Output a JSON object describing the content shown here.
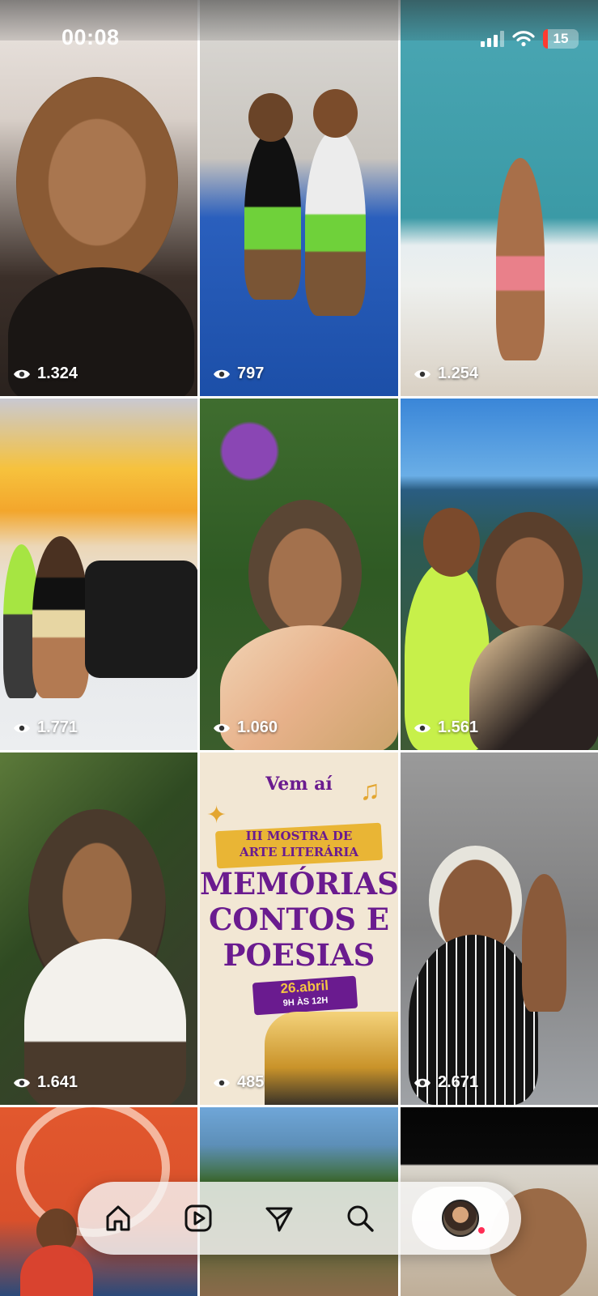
{
  "status_bar": {
    "time": "00:08",
    "battery": "15",
    "icons": [
      "signal-icon",
      "wifi-icon",
      "battery-icon"
    ]
  },
  "grid": {
    "tiles": [
      {
        "views": "1.324"
      },
      {
        "views": "797"
      },
      {
        "views": "1.254"
      },
      {
        "views": "1.771"
      },
      {
        "views": "1.060"
      },
      {
        "views": "1.561"
      },
      {
        "views": "1.641"
      },
      {
        "views": "485"
      },
      {
        "views": "2.671"
      }
    ]
  },
  "poster": {
    "kicker": "Vem aí",
    "subtitle_line1": "III MOSTRA DE",
    "subtitle_line2": "ARTE LITERÁRIA",
    "title_line1": "MEMÓRIAS,",
    "title_line2": "CONTOS E",
    "title_line3": "POESIAS",
    "date": "26.abril",
    "hours": "9H ÀS 12H"
  },
  "bottom_nav": {
    "items": [
      "home-icon",
      "reels-icon",
      "direct-icon",
      "search-icon",
      "profile-avatar"
    ]
  },
  "colors": {
    "poster_purple": "#6a1b8f",
    "notification_dot": "#ff2d55"
  }
}
